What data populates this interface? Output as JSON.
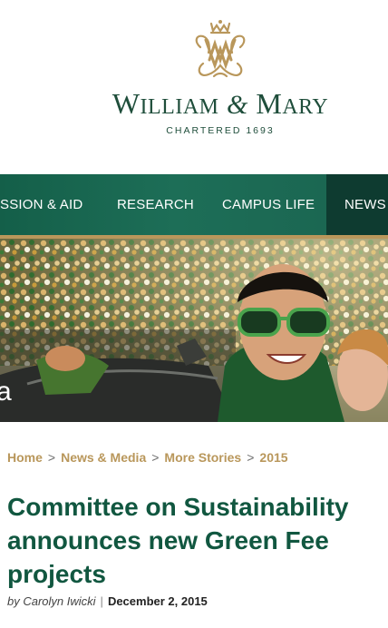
{
  "site": {
    "logo_text": "William & Mary",
    "wordmark": {
      "part1_initial": "W",
      "part1_rest": "ILLIAM",
      "amp": "&",
      "part2_initial": "M",
      "part2_rest": "ARY"
    },
    "chartered": "CHARTERED 1693"
  },
  "nav": {
    "items": [
      {
        "label": "SSION & AID"
      },
      {
        "label": "RESEARCH"
      },
      {
        "label": "CAMPUS LIFE"
      },
      {
        "label": "NEWS"
      }
    ],
    "active": "NEWS"
  },
  "hero": {
    "overlay_text": "a"
  },
  "breadcrumb": {
    "items": [
      {
        "label": "Home"
      },
      {
        "label": "News & Media"
      },
      {
        "label": "More Stories"
      },
      {
        "label": "2015"
      }
    ],
    "separator": ">"
  },
  "article": {
    "title": "Committee on Sustainability announces new Green Fee projects",
    "by": "by",
    "author": "Carolyn Iwicki",
    "separator": "|",
    "date": "December 2, 2015"
  },
  "colors": {
    "brand_green": "#115740",
    "nav_green": "#1d6e57",
    "gold": "#b9975b",
    "active_tab": "#0e3b30"
  }
}
